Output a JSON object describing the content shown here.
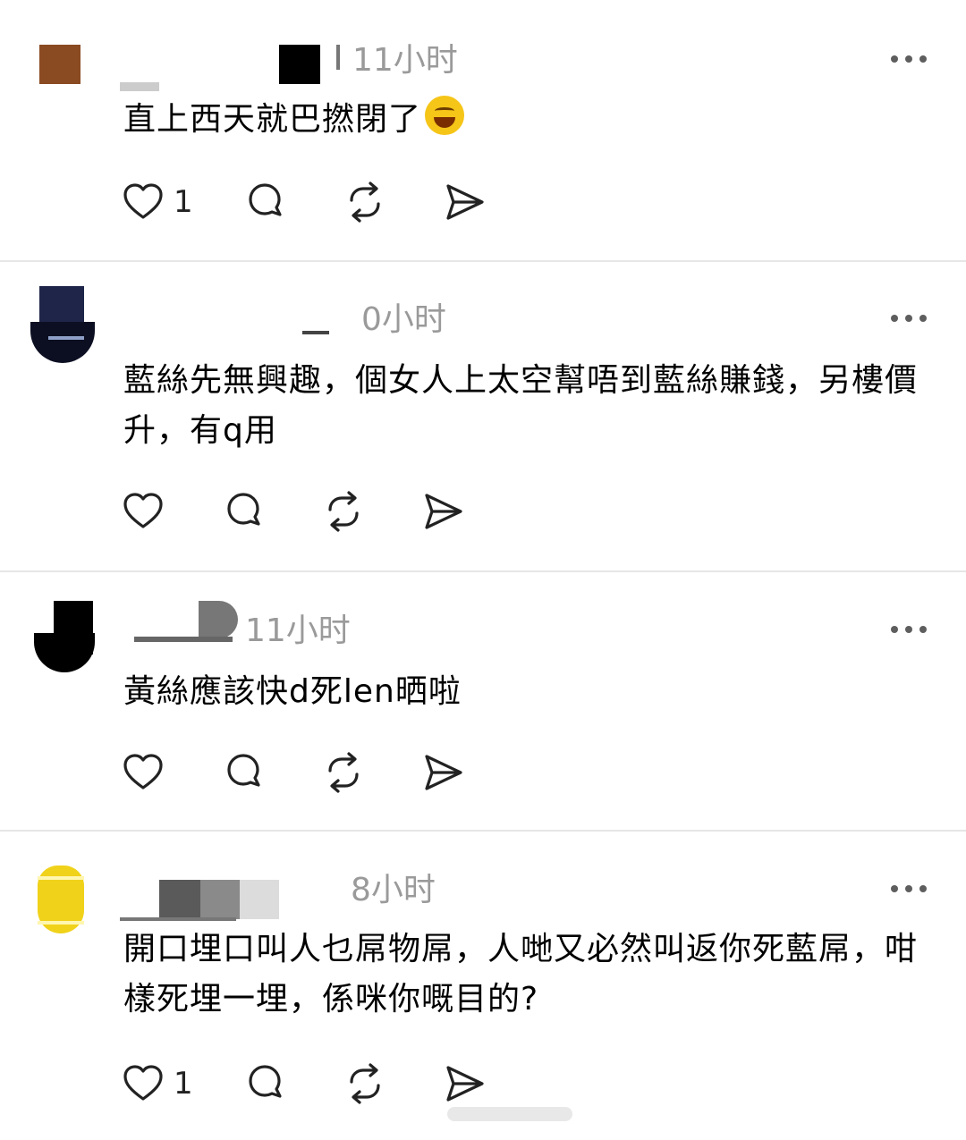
{
  "colors": {
    "background": "#ffffff",
    "time_gray": "#9a9a9a",
    "icon_dark": "#222222",
    "divider": "#e6e6e6"
  },
  "posts": [
    {
      "time": "11小时",
      "text": "直上西天就巴撚閉了",
      "emoji": "rolling-on-floor-laughing",
      "like_count": "1"
    },
    {
      "time": "0小时",
      "text": "藍絲先無興趣，個女人上太空幫唔到藍絲賺錢，另樓價升，有q用",
      "like_count": ""
    },
    {
      "time": "11小时",
      "text": "黃絲應該快d死len晒啦",
      "like_count": ""
    },
    {
      "time": "8小时",
      "text": "開口埋口叫人乜屌物屌，人哋又必然叫返你死藍屌，咁樣死埋一埋，係咪你嘅目的?",
      "like_count": "1"
    }
  ],
  "icons": [
    "heart-icon",
    "comment-icon",
    "repost-icon",
    "share-icon",
    "more-icon"
  ]
}
